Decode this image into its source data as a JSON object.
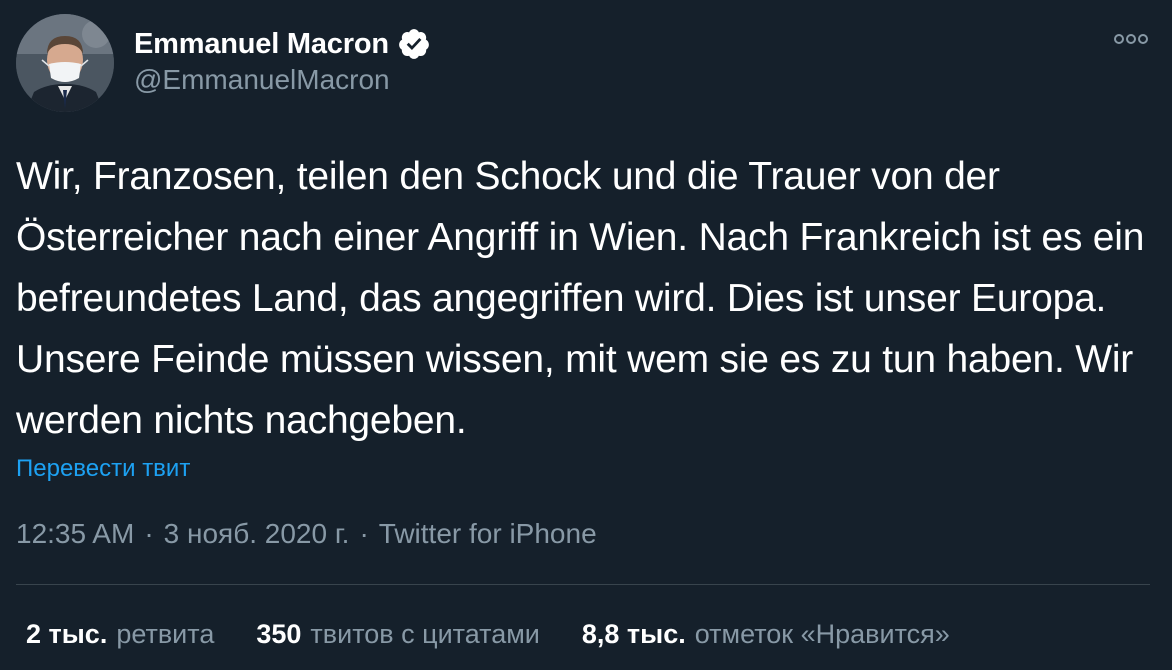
{
  "user": {
    "display_name": "Emmanuel Macron",
    "handle": "@EmmanuelMacron",
    "verified": true,
    "avatar": "profile-photo-man-with-face-mask",
    "verified_icon": "verified-badge-icon"
  },
  "tweet": {
    "text": "Wir, Franzosen, teilen den Schock und die Trauer von der Österreicher nach einer Angriff in Wien. Nach Frankreich ist es ein befreundetes Land, das angegriffen wird. Dies ist unser Europa. Unsere Feinde müssen wissen, mit wem sie es zu tun haben. Wir werden nichts nachgeben.",
    "translate_label": "Перевести твит"
  },
  "meta": {
    "time": "12:35 AM",
    "date": "3 нояб. 2020 г.",
    "separator": "·",
    "source": "Twitter for iPhone"
  },
  "stats": [
    {
      "value": "2 тыс.",
      "label": "ретвита"
    },
    {
      "value": "350",
      "label": "твитов с цитатами"
    },
    {
      "value": "8,8 тыс.",
      "label": "отметок «Нравится»"
    }
  ],
  "icons": {
    "more": "more-options-icon"
  },
  "colors": {
    "background": "#15202b",
    "text": "#ffffff",
    "secondary": "#8899a6",
    "link": "#1da1f2",
    "divider": "#38444d"
  }
}
